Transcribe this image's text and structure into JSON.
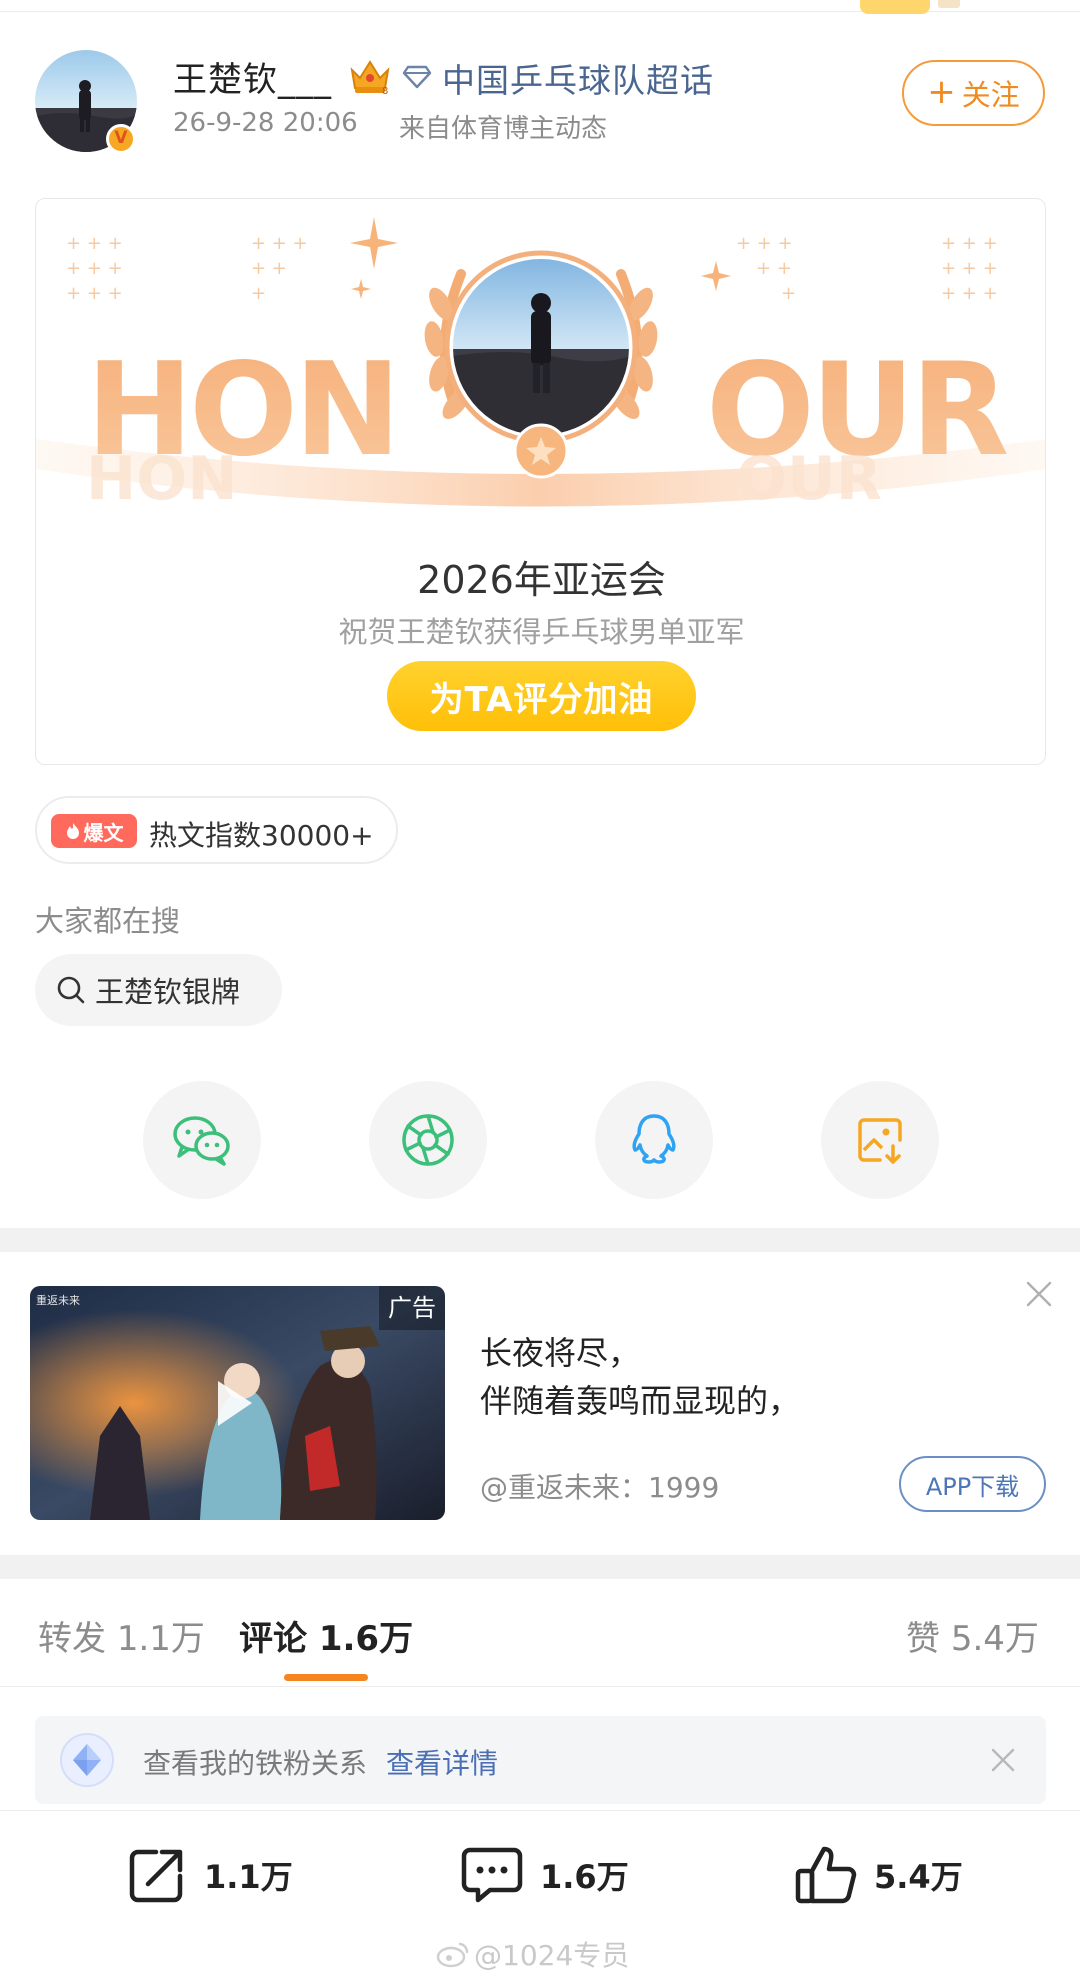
{
  "post": {
    "author": "王楚钦___",
    "topic": "中国乒乓球队超话",
    "time": "26-9-28 20:06",
    "source": "来自体育博主动态",
    "follow_label": "关注",
    "avatar_badge": "V"
  },
  "honour_card": {
    "art_words": [
      "HON",
      "OUR"
    ],
    "title": "2026年亚运会",
    "subtitle": "祝贺王楚钦获得乒乓球男单亚军",
    "button_label": "为TA评分加油"
  },
  "hot": {
    "badge": "爆文",
    "text": "热文指数30000+"
  },
  "search": {
    "label": "大家都在搜",
    "query": "王楚钦银牌"
  },
  "share": {
    "icons": [
      "wechat-icon",
      "moments-icon",
      "qq-icon",
      "save-image-icon"
    ],
    "colors": {
      "wechat": "#3cbf7a",
      "moments": "#3cbf7a",
      "qq": "#2fa3f3",
      "save": "#f5a623"
    }
  },
  "ad": {
    "tag": "广告",
    "line1": "长夜将尽，",
    "line2": "伴随着轰鸣而显现的，",
    "account": "@重返未来：1999",
    "button_label": "APP下载"
  },
  "tabs": {
    "repost_label": "转发",
    "repost_count": "1.1万",
    "comment_label": "评论",
    "comment_count": "1.6万",
    "like_label": "赞",
    "like_count": "5.4万"
  },
  "fan_bar": {
    "text": "查看我的铁粉关系",
    "link": "查看详情"
  },
  "actions": {
    "repost_count": "1.1万",
    "comment_count": "1.6万",
    "like_count": "5.4万"
  },
  "watermark": "@1024专员",
  "colors": {
    "accent_orange": "#f5851f",
    "link_blue": "#4a6690",
    "cheer_yellow": "#ffc412",
    "hot_red": "#ff6a5c"
  }
}
